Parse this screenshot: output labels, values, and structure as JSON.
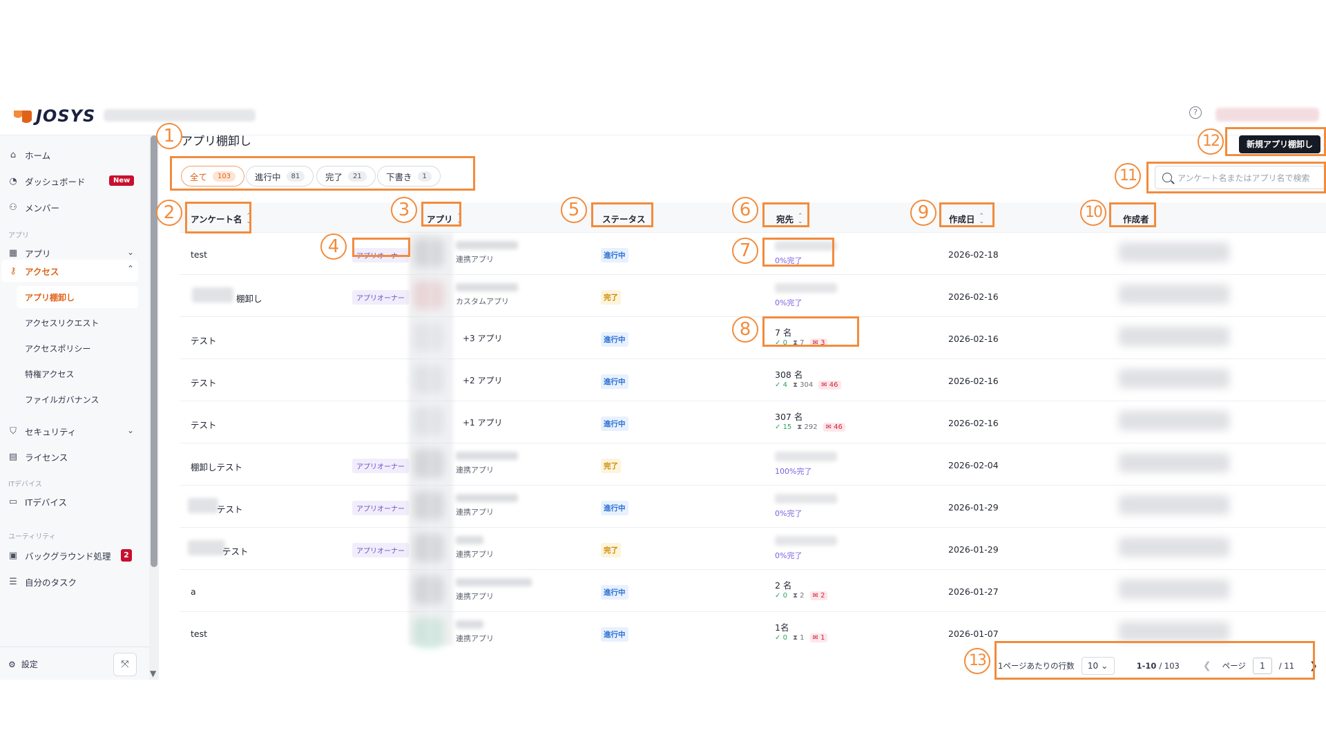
{
  "header": {
    "logo_text": "JOSYS",
    "help_icon": "?"
  },
  "sidebar": {
    "items": [
      {
        "label": "ホーム",
        "icon": "home-icon"
      },
      {
        "label": "ダッシュボード",
        "icon": "dashboard-icon",
        "badge": "New"
      },
      {
        "label": "メンバー",
        "icon": "members-icon"
      }
    ],
    "section_apps": "アプリ",
    "app_item": "アプリ",
    "access_item": "アクセス",
    "access_sub": [
      "アプリ棚卸し",
      "アクセスリクエスト",
      "アクセスポリシー",
      "特権アクセス",
      "ファイルガバナンス"
    ],
    "security_item": "セキュリティ",
    "license_item": "ライセンス",
    "section_devices": "ITデバイス",
    "devices_item": "ITデバイス",
    "section_utility": "ユーティリティ",
    "background_item": "バックグラウンド処理",
    "background_count": "2",
    "tasks_item": "自分のタスク",
    "settings_label": "設定"
  },
  "page": {
    "title": "アプリ棚卸し",
    "new_button": "新規アプリ棚卸し"
  },
  "filters": [
    {
      "label": "全て",
      "count": "103"
    },
    {
      "label": "進行中",
      "count": "81"
    },
    {
      "label": "完了",
      "count": "21"
    },
    {
      "label": "下書き",
      "count": "1"
    }
  ],
  "search": {
    "placeholder": "アンケート名またはアプリ名で検索"
  },
  "columns": {
    "name": "アンケート名",
    "app": "アプリ",
    "status": "ステータス",
    "dest": "宛先",
    "created": "作成日",
    "creator": "作成者"
  },
  "rows": [
    {
      "name": "test",
      "owner_tag": "アプリオーナー",
      "app_sub": "連携アプリ",
      "status": "進行中",
      "dest_pct": "0%完了",
      "date": "2026-02-18"
    },
    {
      "name": "棚卸し",
      "owner_tag": "アプリオーナー",
      "app_sub": "カスタムアプリ",
      "status": "完了",
      "dest_pct": "0%完了",
      "date": "2026-02-16"
    },
    {
      "name": "テスト",
      "app_extra": "+3 アプリ",
      "status": "進行中",
      "dest_count": "7 名",
      "ok": "0",
      "wait": "7",
      "mail": "3",
      "date": "2026-02-16"
    },
    {
      "name": "テスト",
      "app_extra": "+2 アプリ",
      "status": "進行中",
      "dest_count": "308 名",
      "ok": "4",
      "wait": "304",
      "mail": "46",
      "date": "2026-02-16"
    },
    {
      "name": "テスト",
      "app_extra": "+1 アプリ",
      "status": "進行中",
      "dest_count": "307 名",
      "ok": "15",
      "wait": "292",
      "mail": "46",
      "date": "2026-02-16"
    },
    {
      "name": "棚卸しテスト",
      "owner_tag": "アプリオーナー",
      "app_sub": "連携アプリ",
      "status": "完了",
      "dest_pct": "100%完了",
      "date": "2026-02-04"
    },
    {
      "name": "テスト",
      "owner_tag": "アプリオーナー",
      "app_sub": "連携アプリ",
      "status": "進行中",
      "dest_pct": "0%完了",
      "date": "2026-01-29"
    },
    {
      "name": "テスト",
      "owner_tag": "アプリオーナー",
      "app_sub": "連携アプリ",
      "status": "完了",
      "dest_pct": "0%完了",
      "date": "2026-01-29"
    },
    {
      "name": "a",
      "app_sub": "連携アプリ",
      "status": "進行中",
      "dest_count": "2 名",
      "ok": "0",
      "wait": "2",
      "mail": "2",
      "date": "2026-01-27"
    },
    {
      "name": "test",
      "app_sub": "連携アプリ",
      "status": "進行中",
      "dest_count": "1名",
      "ok": "0",
      "wait": "1",
      "mail": "1",
      "date": "2026-01-07"
    }
  ],
  "pagination": {
    "rows_per_page_label": "1ページあたりの行数",
    "rows_per_page": "10",
    "range": "1-10",
    "total": "/ 103",
    "page_label": "ページ",
    "page": "1",
    "page_total": "/ 11"
  },
  "annotations": [
    "1",
    "2",
    "3",
    "4",
    "5",
    "6",
    "7",
    "8",
    "9",
    "10",
    "11",
    "12",
    "13"
  ],
  "colors": {
    "accent": "#e0621a",
    "annotation": "#f28b3c",
    "in_progress": "#2a6fd6",
    "done": "#d08a00"
  }
}
